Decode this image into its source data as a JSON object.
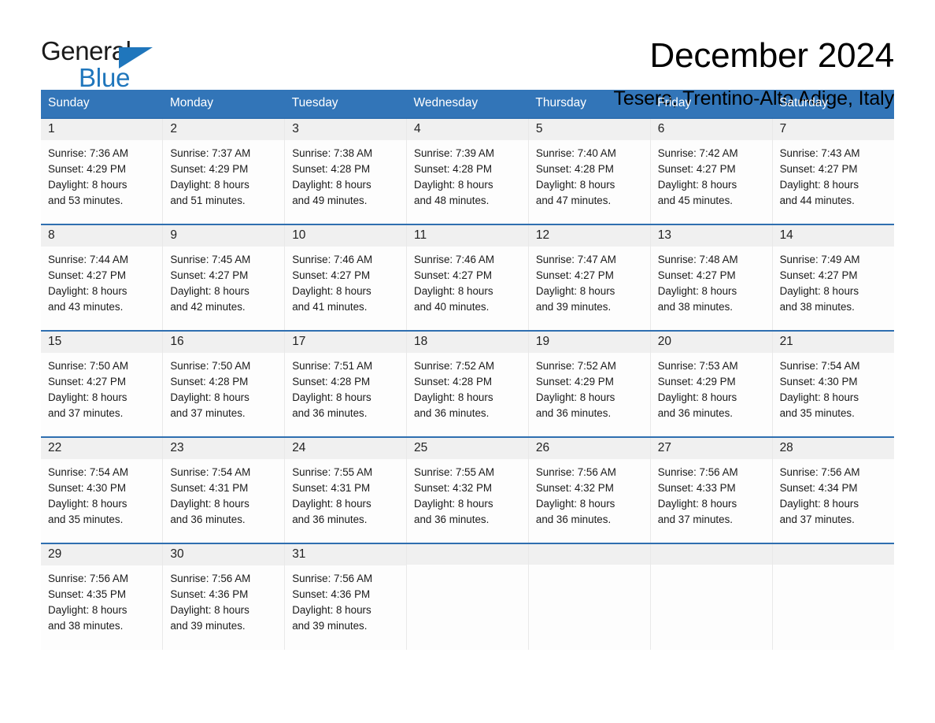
{
  "brand": {
    "name_part1": "General",
    "name_part2": "Blue",
    "accent_color": "#1f76bc"
  },
  "header": {
    "title": "December 2024",
    "location": "Tesero, Trentino-Alto Adige, Italy"
  },
  "calendar": {
    "header_bg": "#3275b8",
    "row_border_color": "#2f6fb0",
    "daynum_bg": "#f0f0f0",
    "weekday_headers": [
      "Sunday",
      "Monday",
      "Tuesday",
      "Wednesday",
      "Thursday",
      "Friday",
      "Saturday"
    ],
    "weeks": [
      [
        {
          "day": "1",
          "sunrise": "Sunrise: 7:36 AM",
          "sunset": "Sunset: 4:29 PM",
          "daylight1": "Daylight: 8 hours",
          "daylight2": "and 53 minutes."
        },
        {
          "day": "2",
          "sunrise": "Sunrise: 7:37 AM",
          "sunset": "Sunset: 4:29 PM",
          "daylight1": "Daylight: 8 hours",
          "daylight2": "and 51 minutes."
        },
        {
          "day": "3",
          "sunrise": "Sunrise: 7:38 AM",
          "sunset": "Sunset: 4:28 PM",
          "daylight1": "Daylight: 8 hours",
          "daylight2": "and 49 minutes."
        },
        {
          "day": "4",
          "sunrise": "Sunrise: 7:39 AM",
          "sunset": "Sunset: 4:28 PM",
          "daylight1": "Daylight: 8 hours",
          "daylight2": "and 48 minutes."
        },
        {
          "day": "5",
          "sunrise": "Sunrise: 7:40 AM",
          "sunset": "Sunset: 4:28 PM",
          "daylight1": "Daylight: 8 hours",
          "daylight2": "and 47 minutes."
        },
        {
          "day": "6",
          "sunrise": "Sunrise: 7:42 AM",
          "sunset": "Sunset: 4:27 PM",
          "daylight1": "Daylight: 8 hours",
          "daylight2": "and 45 minutes."
        },
        {
          "day": "7",
          "sunrise": "Sunrise: 7:43 AM",
          "sunset": "Sunset: 4:27 PM",
          "daylight1": "Daylight: 8 hours",
          "daylight2": "and 44 minutes."
        }
      ],
      [
        {
          "day": "8",
          "sunrise": "Sunrise: 7:44 AM",
          "sunset": "Sunset: 4:27 PM",
          "daylight1": "Daylight: 8 hours",
          "daylight2": "and 43 minutes."
        },
        {
          "day": "9",
          "sunrise": "Sunrise: 7:45 AM",
          "sunset": "Sunset: 4:27 PM",
          "daylight1": "Daylight: 8 hours",
          "daylight2": "and 42 minutes."
        },
        {
          "day": "10",
          "sunrise": "Sunrise: 7:46 AM",
          "sunset": "Sunset: 4:27 PM",
          "daylight1": "Daylight: 8 hours",
          "daylight2": "and 41 minutes."
        },
        {
          "day": "11",
          "sunrise": "Sunrise: 7:46 AM",
          "sunset": "Sunset: 4:27 PM",
          "daylight1": "Daylight: 8 hours",
          "daylight2": "and 40 minutes."
        },
        {
          "day": "12",
          "sunrise": "Sunrise: 7:47 AM",
          "sunset": "Sunset: 4:27 PM",
          "daylight1": "Daylight: 8 hours",
          "daylight2": "and 39 minutes."
        },
        {
          "day": "13",
          "sunrise": "Sunrise: 7:48 AM",
          "sunset": "Sunset: 4:27 PM",
          "daylight1": "Daylight: 8 hours",
          "daylight2": "and 38 minutes."
        },
        {
          "day": "14",
          "sunrise": "Sunrise: 7:49 AM",
          "sunset": "Sunset: 4:27 PM",
          "daylight1": "Daylight: 8 hours",
          "daylight2": "and 38 minutes."
        }
      ],
      [
        {
          "day": "15",
          "sunrise": "Sunrise: 7:50 AM",
          "sunset": "Sunset: 4:27 PM",
          "daylight1": "Daylight: 8 hours",
          "daylight2": "and 37 minutes."
        },
        {
          "day": "16",
          "sunrise": "Sunrise: 7:50 AM",
          "sunset": "Sunset: 4:28 PM",
          "daylight1": "Daylight: 8 hours",
          "daylight2": "and 37 minutes."
        },
        {
          "day": "17",
          "sunrise": "Sunrise: 7:51 AM",
          "sunset": "Sunset: 4:28 PM",
          "daylight1": "Daylight: 8 hours",
          "daylight2": "and 36 minutes."
        },
        {
          "day": "18",
          "sunrise": "Sunrise: 7:52 AM",
          "sunset": "Sunset: 4:28 PM",
          "daylight1": "Daylight: 8 hours",
          "daylight2": "and 36 minutes."
        },
        {
          "day": "19",
          "sunrise": "Sunrise: 7:52 AM",
          "sunset": "Sunset: 4:29 PM",
          "daylight1": "Daylight: 8 hours",
          "daylight2": "and 36 minutes."
        },
        {
          "day": "20",
          "sunrise": "Sunrise: 7:53 AM",
          "sunset": "Sunset: 4:29 PM",
          "daylight1": "Daylight: 8 hours",
          "daylight2": "and 36 minutes."
        },
        {
          "day": "21",
          "sunrise": "Sunrise: 7:54 AM",
          "sunset": "Sunset: 4:30 PM",
          "daylight1": "Daylight: 8 hours",
          "daylight2": "and 35 minutes."
        }
      ],
      [
        {
          "day": "22",
          "sunrise": "Sunrise: 7:54 AM",
          "sunset": "Sunset: 4:30 PM",
          "daylight1": "Daylight: 8 hours",
          "daylight2": "and 35 minutes."
        },
        {
          "day": "23",
          "sunrise": "Sunrise: 7:54 AM",
          "sunset": "Sunset: 4:31 PM",
          "daylight1": "Daylight: 8 hours",
          "daylight2": "and 36 minutes."
        },
        {
          "day": "24",
          "sunrise": "Sunrise: 7:55 AM",
          "sunset": "Sunset: 4:31 PM",
          "daylight1": "Daylight: 8 hours",
          "daylight2": "and 36 minutes."
        },
        {
          "day": "25",
          "sunrise": "Sunrise: 7:55 AM",
          "sunset": "Sunset: 4:32 PM",
          "daylight1": "Daylight: 8 hours",
          "daylight2": "and 36 minutes."
        },
        {
          "day": "26",
          "sunrise": "Sunrise: 7:56 AM",
          "sunset": "Sunset: 4:32 PM",
          "daylight1": "Daylight: 8 hours",
          "daylight2": "and 36 minutes."
        },
        {
          "day": "27",
          "sunrise": "Sunrise: 7:56 AM",
          "sunset": "Sunset: 4:33 PM",
          "daylight1": "Daylight: 8 hours",
          "daylight2": "and 37 minutes."
        },
        {
          "day": "28",
          "sunrise": "Sunrise: 7:56 AM",
          "sunset": "Sunset: 4:34 PM",
          "daylight1": "Daylight: 8 hours",
          "daylight2": "and 37 minutes."
        }
      ],
      [
        {
          "day": "29",
          "sunrise": "Sunrise: 7:56 AM",
          "sunset": "Sunset: 4:35 PM",
          "daylight1": "Daylight: 8 hours",
          "daylight2": "and 38 minutes."
        },
        {
          "day": "30",
          "sunrise": "Sunrise: 7:56 AM",
          "sunset": "Sunset: 4:36 PM",
          "daylight1": "Daylight: 8 hours",
          "daylight2": "and 39 minutes."
        },
        {
          "day": "31",
          "sunrise": "Sunrise: 7:56 AM",
          "sunset": "Sunset: 4:36 PM",
          "daylight1": "Daylight: 8 hours",
          "daylight2": "and 39 minutes."
        },
        {
          "day": "",
          "sunrise": "",
          "sunset": "",
          "daylight1": "",
          "daylight2": ""
        },
        {
          "day": "",
          "sunrise": "",
          "sunset": "",
          "daylight1": "",
          "daylight2": ""
        },
        {
          "day": "",
          "sunrise": "",
          "sunset": "",
          "daylight1": "",
          "daylight2": ""
        },
        {
          "day": "",
          "sunrise": "",
          "sunset": "",
          "daylight1": "",
          "daylight2": ""
        }
      ]
    ]
  }
}
